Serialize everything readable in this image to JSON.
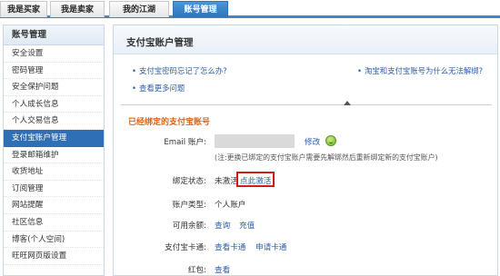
{
  "top_tabs": [
    {
      "label": "我是买家",
      "active": false
    },
    {
      "label": "我是卖家",
      "active": false
    },
    {
      "label": "我的江湖",
      "active": false
    },
    {
      "label": "账号管理",
      "active": true
    }
  ],
  "sidebar": {
    "title": "账号管理",
    "items": [
      {
        "label": "安全设置",
        "active": false
      },
      {
        "label": "密码管理",
        "active": false
      },
      {
        "label": "安全保护问题",
        "active": false
      },
      {
        "label": "个人成长信息",
        "active": false
      },
      {
        "label": "个人交易信息",
        "active": false
      },
      {
        "label": "支付宝账户管理",
        "active": true
      },
      {
        "label": "登录邮箱维护",
        "active": false
      },
      {
        "label": "收货地址",
        "active": false
      },
      {
        "label": "订阅管理",
        "active": false
      },
      {
        "label": "网站提醒",
        "active": false
      },
      {
        "label": "社区信息",
        "active": false
      },
      {
        "label": "博客(个人空间)",
        "active": false
      },
      {
        "label": "旺旺网页版设置",
        "active": false
      }
    ]
  },
  "main": {
    "title": "支付宝账户管理",
    "help_links": [
      "支付宝密码忘记了怎么办?",
      "淘宝和支付宝账号为什么无法解绑?",
      "查看更多问题"
    ],
    "bullet": "•",
    "section_title": "已经绑定的支付宝账号",
    "email_label": "Email 账户:",
    "modify_link": "修改",
    "note": "(注:更换已绑定的支付宝账户需要先解绑然后重新绑定新的支付宝账户)",
    "bind_status_label": "绑定状态:",
    "bind_status_value": "未激活",
    "activate_link": "点此激活",
    "account_type_label": "账户类型:",
    "account_type_value": "个人账户",
    "balance_label": "可用余额:",
    "balance_links": [
      "查询",
      "充值"
    ],
    "card_label": "支付宝卡通:",
    "card_links": [
      "查看卡通",
      "申请卡通"
    ],
    "redpacket_label": "红包:",
    "redpacket_link": "查看"
  },
  "colors": {
    "accent_blue": "#2f6fb5",
    "section_orange": "#d9661e",
    "link_blue": "#2b5ea8",
    "highlight_red": "#d11a1a"
  }
}
